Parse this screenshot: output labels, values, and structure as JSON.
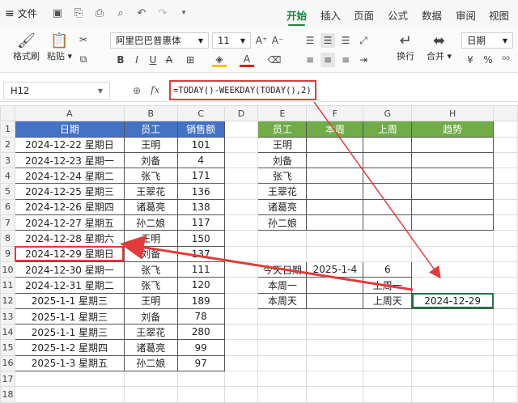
{
  "menubar": {
    "file_label": "文件",
    "tabs": [
      "开始",
      "插入",
      "页面",
      "公式",
      "数据",
      "审阅",
      "视图"
    ],
    "active_tab": "开始"
  },
  "ribbon": {
    "format_painter": "格式刷",
    "paste": "粘贴",
    "font_name": "阿里巴巴普惠体",
    "font_size": "11",
    "wrap": "换行",
    "merge": "合并",
    "number_format": "日期"
  },
  "formula_bar": {
    "cell_ref": "H12",
    "fx": "fx",
    "formula": "=TODAY()-WEEKDAY(TODAY(),2)"
  },
  "columns": [
    "A",
    "B",
    "C",
    "D",
    "E",
    "F",
    "G",
    "H"
  ],
  "rows": [
    "1",
    "2",
    "3",
    "4",
    "5",
    "6",
    "7",
    "8",
    "9",
    "10",
    "11",
    "12",
    "13",
    "14",
    "15",
    "16",
    "17",
    "18"
  ],
  "left_table": {
    "headers": [
      "日期",
      "员工",
      "销售额"
    ],
    "rows": [
      [
        "2024-12-22 星期日",
        "王明",
        "101"
      ],
      [
        "2024-12-23 星期一",
        "刘备",
        "4"
      ],
      [
        "2024-12-24 星期二",
        "张飞",
        "171"
      ],
      [
        "2024-12-25 星期三",
        "王翠花",
        "136"
      ],
      [
        "2024-12-26 星期四",
        "诸葛亮",
        "138"
      ],
      [
        "2024-12-27 星期五",
        "孙二娘",
        "117"
      ],
      [
        "2024-12-28 星期六",
        "王明",
        "150"
      ],
      [
        "2024-12-29 星期日",
        "刘备",
        "137"
      ],
      [
        "2024-12-30 星期一",
        "张飞",
        "111"
      ],
      [
        "2024-12-31 星期二",
        "张飞",
        "120"
      ],
      [
        "2025-1-1 星期三",
        "王明",
        "189"
      ],
      [
        "2025-1-1 星期三",
        "刘备",
        "78"
      ],
      [
        "2025-1-1 星期三",
        "王翠花",
        "280"
      ],
      [
        "2025-1-2 星期四",
        "诸葛亮",
        "99"
      ],
      [
        "2025-1-3 星期五",
        "孙二娘",
        "97"
      ]
    ]
  },
  "right_table": {
    "headers": [
      "员工",
      "本周",
      "上周",
      "趋势"
    ],
    "names": [
      "王明",
      "刘备",
      "张飞",
      "王翠花",
      "诸葛亮",
      "孙二娘"
    ]
  },
  "info": {
    "today_label": "今天日期",
    "today_value": "2025-1-4",
    "today_num": "6",
    "monday_label": "本周一",
    "last_monday_label": "上周一",
    "weekday_label": "本周天",
    "last_sunday_label": "上周天",
    "last_sunday_value": "2024-12-29"
  },
  "colors": {
    "accent": "#0f8a3a",
    "blue_header": "#4472c4",
    "green_header": "#70ad47",
    "annotation": "#e23b3b"
  }
}
